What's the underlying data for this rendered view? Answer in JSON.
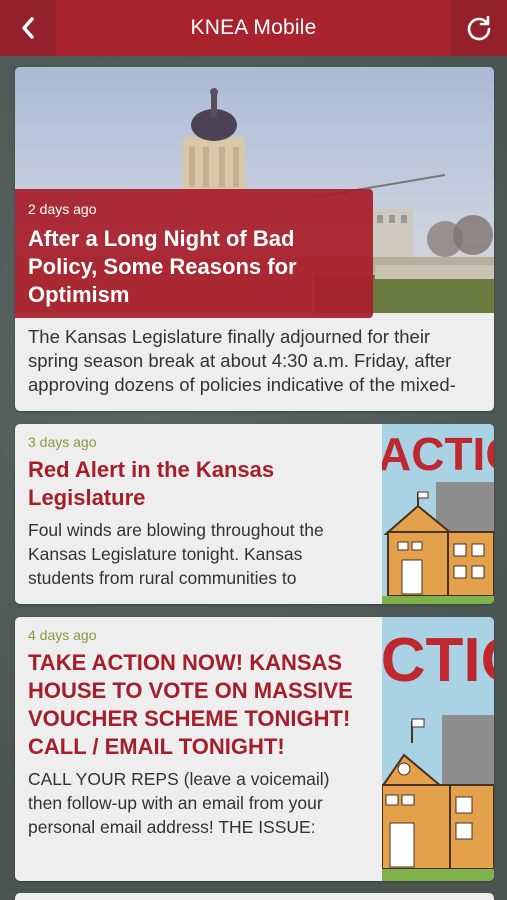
{
  "header": {
    "title": "KNEA Mobile",
    "back_icon": "chevron-left-icon",
    "refresh_icon": "refresh-icon",
    "bar_color": "#a8232c"
  },
  "featured": {
    "time": "2 days ago",
    "title": "After a Long Night of Bad Policy, Some Reasons for Optimism",
    "excerpt": "The Kansas Legislature finally adjourned for their spring season break at about 4:30 a.m. Friday, after approving dozens of policies indicative of the mixed-"
  },
  "articles": [
    {
      "time": "3 days ago",
      "title": "Red Alert in the Kansas Legislature",
      "excerpt": "Foul winds are blowing throughout the Kansas Legislature tonight. Kansas students from rural communities to",
      "thumb_text": "ACTION"
    },
    {
      "time": "4 days ago",
      "title": "TAKE ACTION NOW! KANSAS HOUSE TO VOTE ON MASSIVE VOUCHER SCHEME TONIGHT! CALL / EMAIL TONIGHT!",
      "excerpt": "CALL YOUR REPS (leave a voicemail) then follow-up with an email from your personal email address! THE ISSUE:",
      "thumb_text": "ACTION"
    }
  ]
}
